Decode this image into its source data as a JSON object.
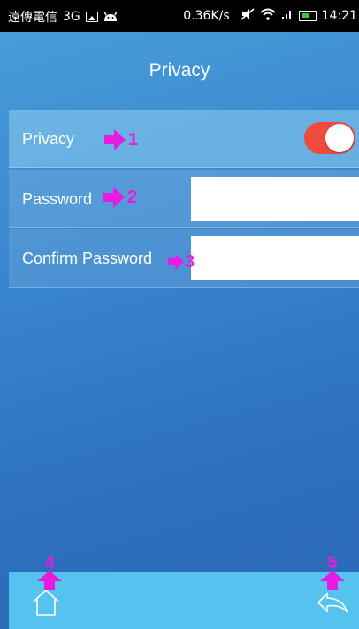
{
  "status_bar": {
    "carrier": "遠傳電信",
    "network": "3G",
    "speed": "0.36K/s",
    "time": "14:21",
    "icons": [
      "image-icon",
      "android-icon",
      "mute-icon",
      "wifi-icon",
      "signal-icon",
      "battery-icon"
    ]
  },
  "header": {
    "title": "Privacy"
  },
  "settings": {
    "privacy": {
      "label": "Privacy",
      "toggle_on": true
    },
    "password": {
      "label": "Password",
      "value": "",
      "placeholder": ""
    },
    "confirm_password": {
      "label": "Confirm Password",
      "value": "",
      "placeholder": ""
    }
  },
  "annotations": {
    "a1": "1",
    "a2": "2",
    "a3": "3",
    "a4": "4",
    "a5": "5"
  },
  "bottom_bar": {
    "icons": [
      "home-icon",
      "back-icon"
    ]
  },
  "colors": {
    "annotation": "#e81ce0",
    "toggle_on": "#ee4a3d",
    "bottom_bar": "#55c3ee",
    "background": "#2f7fc8"
  }
}
